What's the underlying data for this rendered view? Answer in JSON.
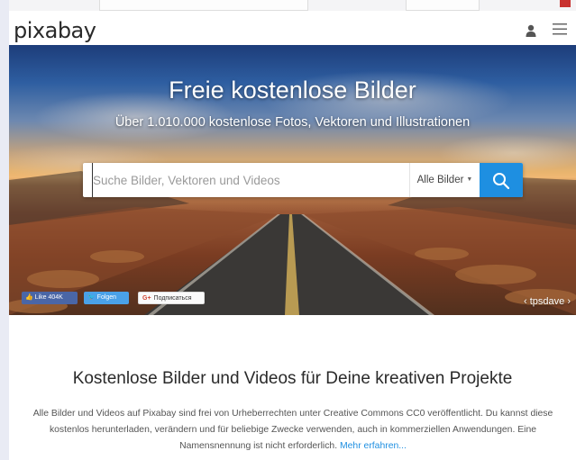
{
  "header": {
    "logo": "pixabay",
    "user_icon": "user-icon",
    "menu_icon": "hamburger-menu-icon"
  },
  "hero": {
    "title": "Freie kostenlose Bilder",
    "subtitle": "Über 1.010.000 kostenlose Fotos, Vektoren und Illustrationen",
    "search": {
      "placeholder": "Suche Bilder, Vektoren und Videos",
      "type_selected": "Alle Bilder",
      "button_icon": "search-icon"
    },
    "social": {
      "facebook": "Like 404K",
      "twitter": "Folgen",
      "googleplus": "Подписаться"
    },
    "credit": "‹ tpsdave ›"
  },
  "main": {
    "title": "Kostenlose Bilder und Videos für Deine kreativen Projekte",
    "description": "Alle Bilder und Videos auf Pixabay sind frei von Urheberrechten unter Creative Commons CC0 veröffentlicht. Du kannst diese kostenlos herunterladen, verändern und für beliebige Zwecke verwenden, auch in kommerziellen Anwendungen. Eine Namensnennung ist nicht erforderlich.",
    "more_link": "Mehr erfahren..."
  },
  "colors": {
    "accent": "#1e8fe1",
    "facebook": "#4a66a6",
    "twitter": "#4aa1e8"
  }
}
